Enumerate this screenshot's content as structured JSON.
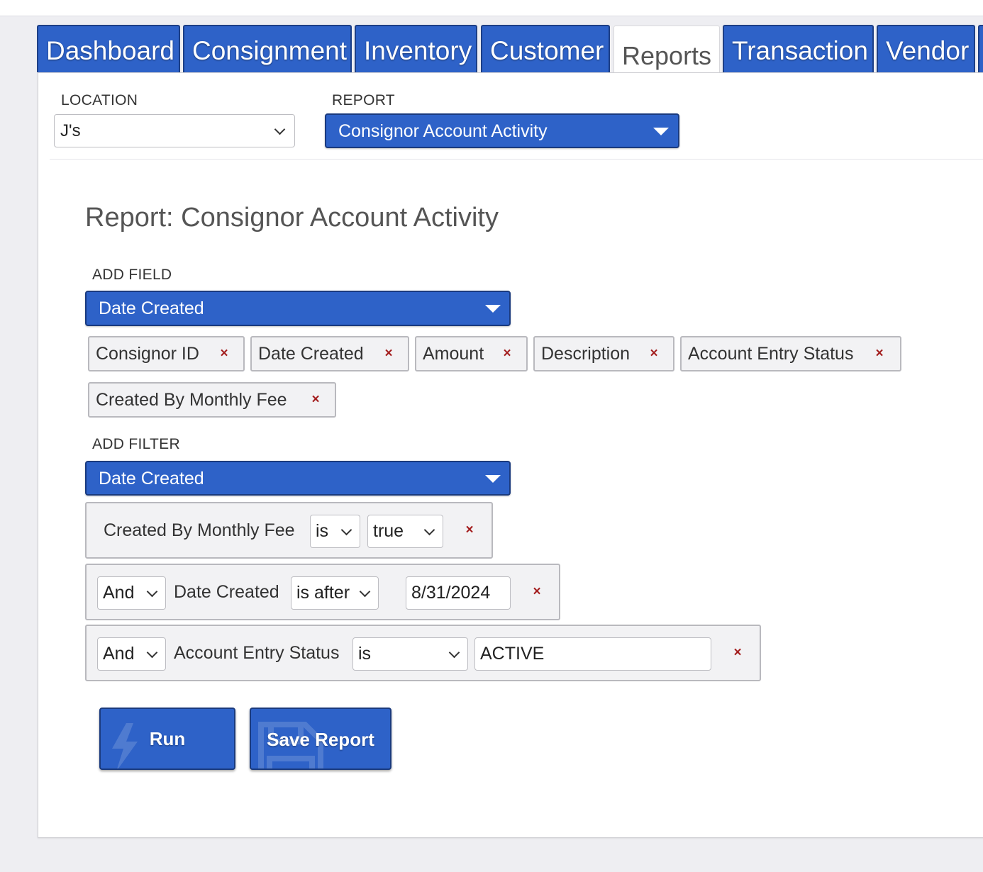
{
  "tabs": [
    {
      "label": "Dashboard",
      "active": false
    },
    {
      "label": "Consignment",
      "active": false
    },
    {
      "label": "Inventory",
      "active": false
    },
    {
      "label": "Customer",
      "active": false
    },
    {
      "label": "Reports",
      "active": true
    },
    {
      "label": "Transaction",
      "active": false
    },
    {
      "label": "Vendor",
      "active": false
    }
  ],
  "location": {
    "label": "LOCATION",
    "value": "J's"
  },
  "report": {
    "label": "REPORT",
    "value": "Consignor Account Activity"
  },
  "title": "Report: Consignor Account Activity",
  "add_field": {
    "label": "ADD FIELD",
    "selected": "Date Created",
    "chips": [
      "Consignor ID",
      "Date Created",
      "Amount",
      "Description",
      "Account Entry Status",
      "Created By Monthly Fee"
    ]
  },
  "add_filter": {
    "label": "ADD FILTER",
    "selected": "Date Created",
    "filters": [
      {
        "field": "Created By Monthly Fee",
        "operator": "is",
        "value": "true"
      },
      {
        "conjunction": "And",
        "field": "Date Created",
        "operator": "is after",
        "value": "8/31/2024"
      },
      {
        "conjunction": "And",
        "field": "Account Entry Status",
        "operator": "is",
        "value": "ACTIVE"
      }
    ]
  },
  "remove_glyph": "×",
  "buttons": {
    "run": "Run",
    "save": "Save Report"
  },
  "colors": {
    "accent": "#2e62c8",
    "accent_border": "#1a3a7e",
    "remove": "#a31d1d"
  }
}
